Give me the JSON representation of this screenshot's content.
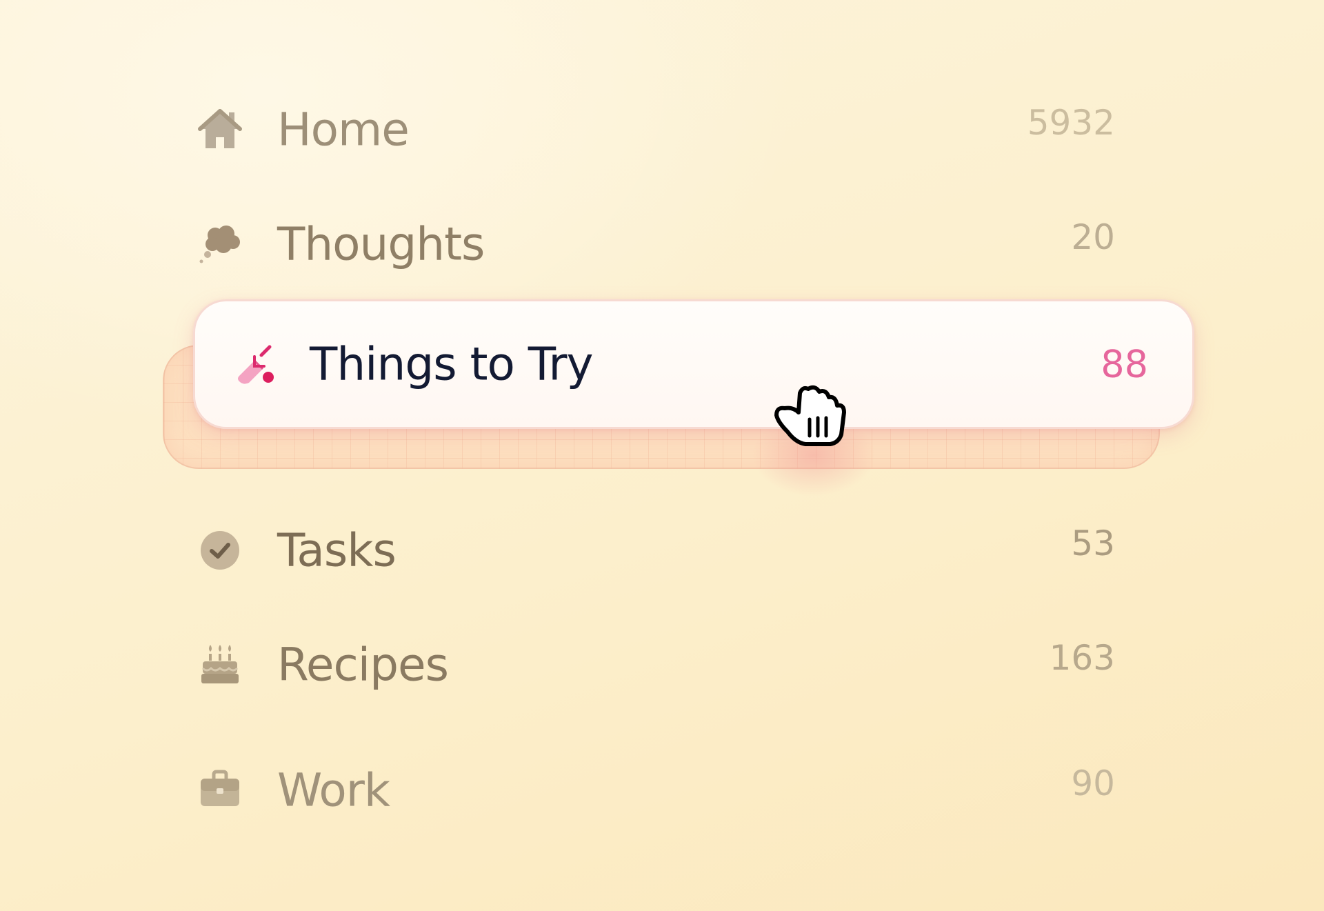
{
  "sidebar": {
    "items": [
      {
        "label": "Home",
        "count": "5932",
        "icon": "home-icon"
      },
      {
        "label": "Thoughts",
        "count": "20",
        "icon": "thought-bubble-icon"
      },
      {
        "label": "Things to Try",
        "count": "88",
        "icon": "wand-icon",
        "state": "dragging"
      },
      {
        "label": "Tasks",
        "count": "53",
        "icon": "checkmark-circle-icon"
      },
      {
        "label": "Recipes",
        "count": "163",
        "icon": "cake-icon"
      },
      {
        "label": "Work",
        "count": "90",
        "icon": "briefcase-icon"
      }
    ]
  },
  "cursor": {
    "icon": "grab-hand-cursor-icon"
  },
  "colors": {
    "background": "#fcefcc",
    "drag_accent": "#e6669c",
    "drag_label": "#131a33",
    "muted_label": "#8f7f66",
    "drop_slot": "#fde0c0"
  }
}
